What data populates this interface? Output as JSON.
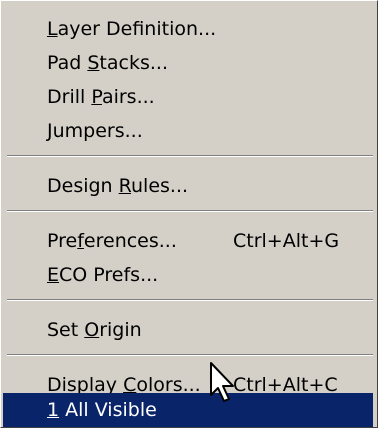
{
  "menu": {
    "items": [
      {
        "pre": "",
        "key": "L",
        "post": "ayer Definition...",
        "shortcut": ""
      },
      {
        "pre": "Pad ",
        "key": "S",
        "post": "tacks...",
        "shortcut": ""
      },
      {
        "pre": "Drill ",
        "key": "P",
        "post": "airs...",
        "shortcut": ""
      },
      {
        "pre": "",
        "key": "J",
        "post": "umpers...",
        "shortcut": ""
      },
      {
        "pre": "Design ",
        "key": "R",
        "post": "ules...",
        "shortcut": ""
      },
      {
        "pre": "Pre",
        "key": "f",
        "post": "erences...",
        "shortcut": "Ctrl+Alt+G"
      },
      {
        "pre": "",
        "key": "E",
        "post": "CO Prefs...",
        "shortcut": ""
      },
      {
        "pre": "Set ",
        "key": "O",
        "post": "rigin",
        "shortcut": ""
      },
      {
        "pre": "Display ",
        "key": "C",
        "post": "olors...",
        "shortcut": "Ctrl+Alt+C"
      },
      {
        "pre": "",
        "key": "1",
        "post": " All Visible",
        "shortcut": ""
      }
    ]
  },
  "colors": {
    "menu_bg": "#d4d0c8",
    "highlight_bg": "#0a246a",
    "highlight_text": "#ffffff",
    "separator_dark": "#808080"
  },
  "icons": {
    "cursor": "mouse-pointer-arrow-icon"
  }
}
